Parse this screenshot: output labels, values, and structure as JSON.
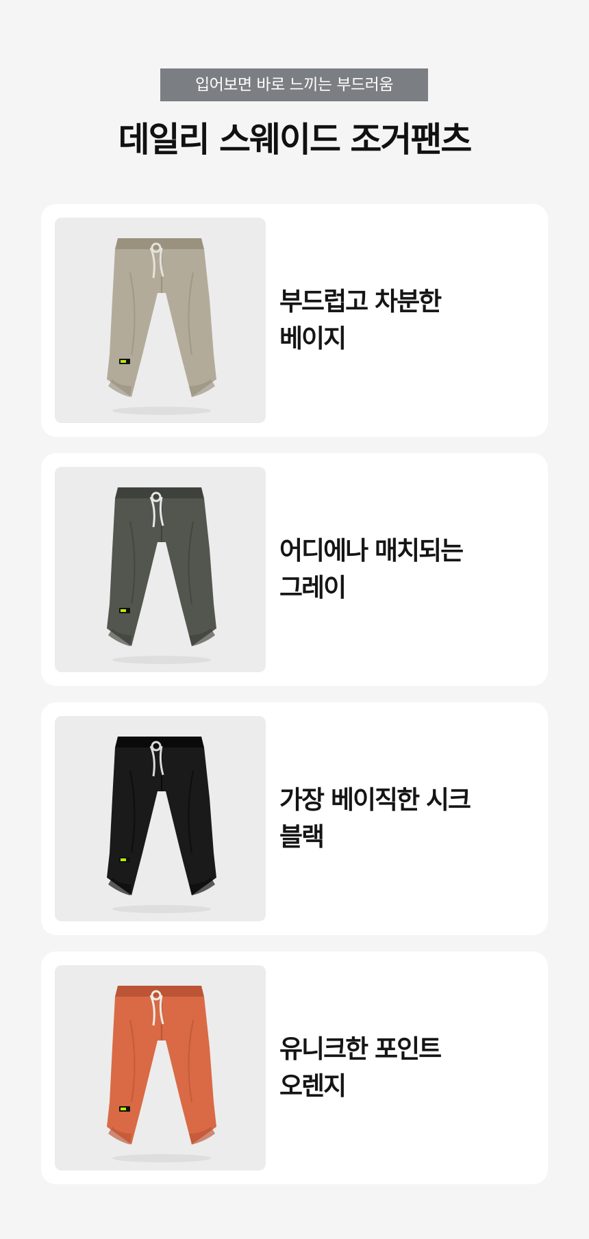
{
  "header": {
    "tagline": "입어보면 바로 느끼는 부드러움",
    "title": "데일리 스웨이드 조거팬츠"
  },
  "products": [
    {
      "line1": "부드럽고 차분한",
      "line2": "베이지",
      "pants_color": "#b3ab9a",
      "shade_color": "#9a917f",
      "cord_color": "#e6e3dc"
    },
    {
      "line1": "어디에나 매치되는",
      "line2": "그레이",
      "pants_color": "#53564f",
      "shade_color": "#3f423c",
      "cord_color": "#e8e8e8"
    },
    {
      "line1": "가장 베이직한 시크",
      "line2": "블랙",
      "pants_color": "#1a1a1a",
      "shade_color": "#0a0a0a",
      "cord_color": "#dcdcdc"
    },
    {
      "line1": "유니크한 포인트",
      "line2": "오렌지",
      "pants_color": "#d96a45",
      "shade_color": "#bb5535",
      "cord_color": "#f1ede6"
    }
  ],
  "colors": {
    "page_background": "#f5f5f5",
    "badge_background": "#7b7e82",
    "photo_background": "#ececec",
    "patch_accent": "#b8f000"
  },
  "icons": [
    "jogger-pants-photo"
  ]
}
